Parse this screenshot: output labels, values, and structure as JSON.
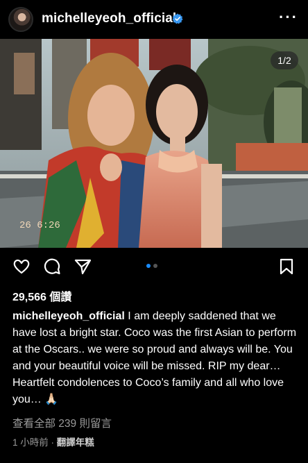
{
  "header": {
    "username": "michelleyeoh_official",
    "more_icon": "more-horizontal-icon",
    "verified_color": "#3897f0"
  },
  "photo": {
    "counter": "1/2",
    "date_stamp": "26  6:26"
  },
  "actions": {
    "like_icon": "heart-icon",
    "comment_icon": "comment-icon",
    "share_icon": "send-icon",
    "save_icon": "bookmark-icon"
  },
  "carousel": {
    "count": 2,
    "active": 1,
    "active_color": "#1a8cff"
  },
  "post": {
    "views": "29,566 個讚",
    "caption_user": "michelleyeoh_official",
    "caption_text": "I am deeply saddened that we have lost a bright star. Coco was the first Asian to perform at the Oscars.. we were so proud and always will be. You and your beautiful voice will be missed. RIP my dear… Heartfelt condolences to Coco’s family and all who love you… 🙏🏻",
    "comments_link": "查看全部 239 則留言",
    "time": "1 小時前",
    "separator": "·",
    "translate": "翻譯年糕"
  }
}
